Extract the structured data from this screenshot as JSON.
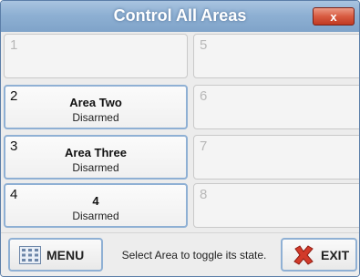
{
  "window": {
    "title": "Control All Areas",
    "close_glyph": "x"
  },
  "areas": [
    {
      "number": "1",
      "name": "",
      "state": ""
    },
    {
      "number": "2",
      "name": "Area Two",
      "state": "Disarmed"
    },
    {
      "number": "3",
      "name": "Area Three",
      "state": "Disarmed"
    },
    {
      "number": "4",
      "name": "4",
      "state": "Disarmed"
    },
    {
      "number": "5",
      "name": "",
      "state": ""
    },
    {
      "number": "6",
      "name": "",
      "state": ""
    },
    {
      "number": "7",
      "name": "",
      "state": ""
    },
    {
      "number": "8",
      "name": "",
      "state": ""
    }
  ],
  "footer": {
    "menu_label": "MENU",
    "status_text": "Select Area to toggle its state.",
    "exit_label": "EXIT"
  },
  "colors": {
    "title_bar": "#8eb0d3",
    "close_button": "#d85b41",
    "active_border": "#8fb0d4",
    "exit_x": "#d23a2a"
  },
  "icons": {
    "menu": "menu-grid-icon",
    "exit": "red-x-icon"
  }
}
